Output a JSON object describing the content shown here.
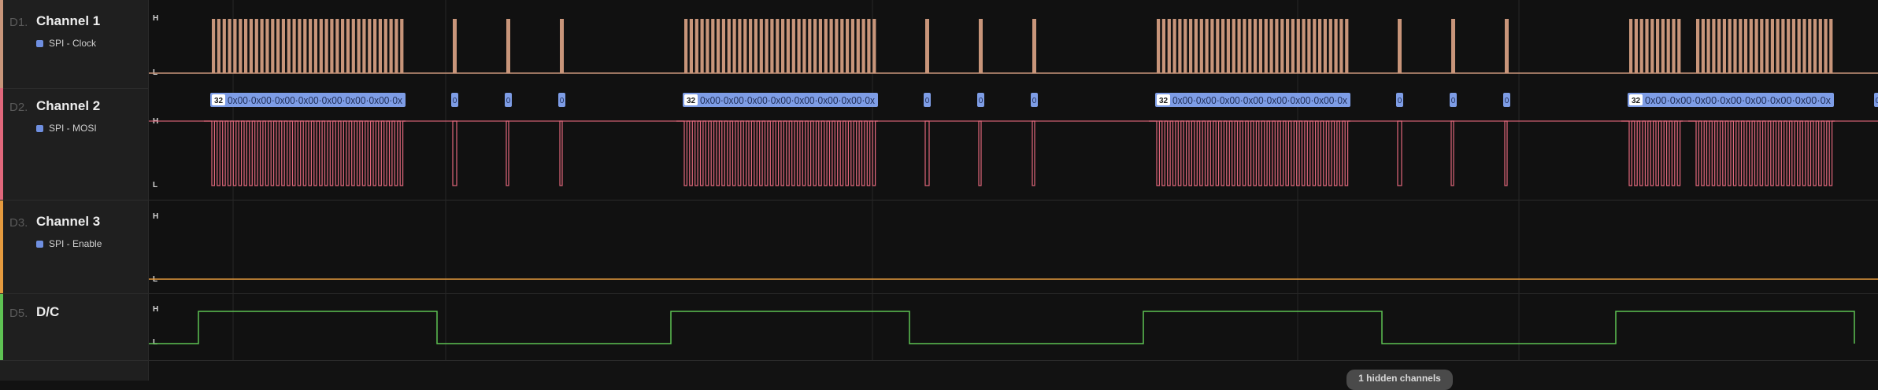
{
  "channels": [
    {
      "index": "D1.",
      "name": "Channel 1",
      "analyzer": "SPI - Clock",
      "color": "#c8957a"
    },
    {
      "index": "D2.",
      "name": "Channel 2",
      "analyzer": "SPI - MOSI",
      "color": "#e0677b"
    },
    {
      "index": "D3.",
      "name": "Channel 3",
      "analyzer": "SPI - Enable",
      "color": "#e59a3e"
    },
    {
      "index": "D5.",
      "name": "D/C",
      "analyzer": "",
      "color": "#5ec253"
    }
  ],
  "level_labels": {
    "high": "H",
    "low": "L"
  },
  "decode": {
    "count": "32",
    "bytes_text": "0x00·0x00·0x00·0x00·0x00·0x00·0x00·0x",
    "single_marker": "0"
  },
  "footer": {
    "hidden_channels": "1 hidden channels"
  },
  "colors": {
    "decode_bg": "#7e9de6",
    "background": "#121212",
    "sidebar": "#1f1f1f"
  }
}
